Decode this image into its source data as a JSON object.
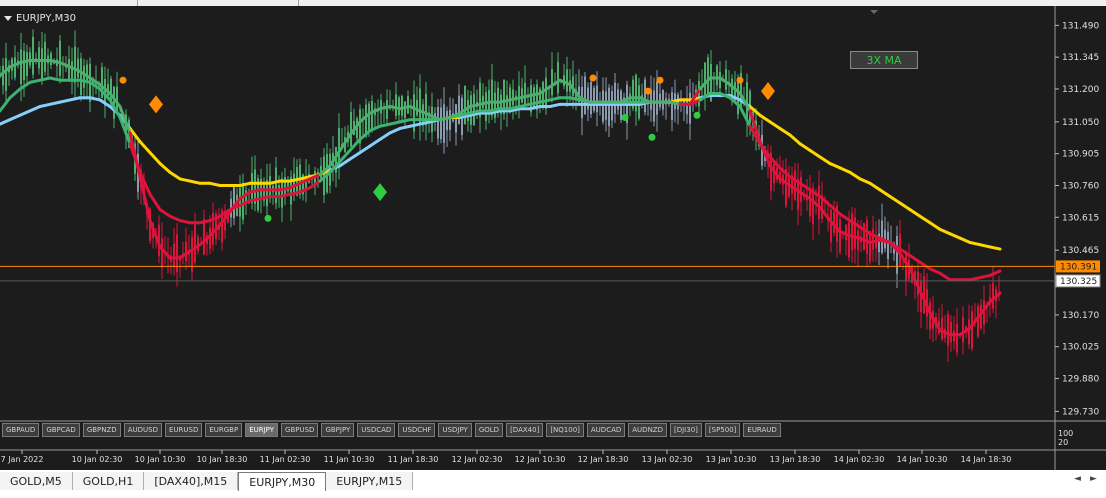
{
  "window": {
    "symbol_timeframe": "EURJPY,M30",
    "indicator_button": "3X MA"
  },
  "symbol_buttons": [
    {
      "label": "GBPAUD",
      "active": false
    },
    {
      "label": "GBPCAD",
      "active": false
    },
    {
      "label": "GBPNZD",
      "active": false
    },
    {
      "label": "AUDUSD",
      "active": false
    },
    {
      "label": "EURUSD",
      "active": false
    },
    {
      "label": "EURGBP",
      "active": false
    },
    {
      "label": "EURJPY",
      "active": true
    },
    {
      "label": "GBPUSD",
      "active": false
    },
    {
      "label": "GBPJPY",
      "active": false
    },
    {
      "label": "USDCAD",
      "active": false
    },
    {
      "label": "USDCHF",
      "active": false
    },
    {
      "label": "USDJPY",
      "active": false
    },
    {
      "label": "GOLD",
      "active": false
    },
    {
      "label": "[DAX40]",
      "active": false
    },
    {
      "label": "[NQ100]",
      "active": false
    },
    {
      "label": "AUDCAD",
      "active": false
    },
    {
      "label": "AUDNZD",
      "active": false
    },
    {
      "label": "[DJI30]",
      "active": false
    },
    {
      "label": "[SP500]",
      "active": false
    },
    {
      "label": "EURAUD",
      "active": false
    }
  ],
  "tabs": [
    {
      "label": "GOLD,M5",
      "active": false
    },
    {
      "label": "GOLD,H1",
      "active": false
    },
    {
      "label": "[DAX40],M15",
      "active": false
    },
    {
      "label": "EURJPY,M30",
      "active": true
    },
    {
      "label": "EURJPY,M15",
      "active": false
    }
  ],
  "chart_data": {
    "type": "line",
    "title": "EURJPY,M30",
    "ylim": [
      129.7,
      131.56
    ],
    "y_ticks": [
      131.49,
      131.345,
      131.2,
      131.05,
      130.905,
      130.76,
      130.615,
      130.465,
      130.32,
      130.17,
      130.025,
      129.88,
      129.73
    ],
    "x_tick_labels": [
      "7 Jan 2022",
      "10 Jan 02:30",
      "10 Jan 10:30",
      "10 Jan 18:30",
      "11 Jan 02:30",
      "11 Jan 10:30",
      "11 Jan 18:30",
      "12 Jan 02:30",
      "12 Jan 10:30",
      "12 Jan 18:30",
      "13 Jan 02:30",
      "13 Jan 10:30",
      "13 Jan 18:30",
      "14 Jan 02:30",
      "14 Jan 10:30",
      "14 Jan 18:30"
    ],
    "x": [
      0,
      10,
      20,
      30,
      40,
      50,
      60,
      70,
      80,
      90,
      100,
      110,
      120,
      130,
      140,
      150,
      160,
      170,
      180,
      190,
      200,
      210,
      220,
      230,
      240,
      250,
      260,
      270,
      280,
      290,
      300,
      310,
      320,
      330,
      340,
      350,
      360,
      370,
      380,
      390,
      400,
      410,
      420,
      430,
      440,
      450,
      460,
      470,
      480,
      490,
      500,
      510,
      520,
      530,
      540,
      550,
      560,
      570,
      580,
      590,
      600,
      610,
      620,
      630,
      640,
      650,
      660,
      670,
      680,
      690,
      700,
      710,
      720,
      730,
      740,
      750,
      760,
      770,
      780,
      790,
      800,
      810,
      820,
      830,
      840,
      850,
      860,
      870,
      880,
      890,
      900,
      910,
      920,
      930,
      940,
      950,
      960,
      970,
      980,
      990,
      1000
    ],
    "series": [
      {
        "name": "fast",
        "color_up": "#4caf6e",
        "color_down": "#dc143c",
        "values": [
          131.26,
          131.3,
          131.32,
          131.33,
          131.33,
          131.33,
          131.32,
          131.3,
          131.28,
          131.25,
          131.22,
          131.18,
          131.12,
          131.0,
          130.8,
          130.6,
          130.48,
          130.43,
          130.43,
          130.46,
          130.49,
          130.53,
          130.58,
          130.64,
          130.7,
          130.73,
          130.74,
          130.74,
          130.74,
          130.75,
          130.77,
          130.79,
          130.81,
          130.85,
          130.92,
          130.99,
          131.05,
          131.09,
          131.11,
          131.12,
          131.11,
          131.12,
          131.1,
          131.08,
          131.06,
          131.07,
          131.09,
          131.12,
          131.13,
          131.14,
          131.14,
          131.15,
          131.16,
          131.17,
          131.18,
          131.21,
          131.24,
          131.22,
          131.16,
          131.14,
          131.14,
          131.14,
          131.14,
          131.16,
          131.16,
          131.14,
          131.14,
          131.14,
          131.13,
          131.13,
          131.2,
          131.25,
          131.25,
          131.22,
          131.18,
          131.1,
          130.96,
          130.85,
          130.79,
          130.76,
          130.73,
          130.7,
          130.66,
          130.6,
          130.55,
          130.53,
          130.52,
          130.5,
          130.51,
          130.5,
          130.45,
          130.38,
          130.28,
          130.18,
          130.1,
          130.08,
          130.08,
          130.11,
          130.17,
          130.23,
          130.27
        ]
      },
      {
        "name": "mid",
        "color_up": "#3cb371",
        "color_down": "#dc143c",
        "values": [
          131.1,
          131.16,
          131.2,
          131.23,
          131.24,
          131.25,
          131.24,
          131.24,
          131.24,
          131.23,
          131.2,
          131.15,
          131.07,
          130.95,
          130.82,
          130.72,
          130.65,
          130.62,
          130.6,
          130.59,
          130.59,
          130.6,
          130.62,
          130.65,
          130.67,
          130.69,
          130.7,
          130.71,
          130.71,
          130.72,
          130.73,
          130.75,
          130.78,
          130.82,
          130.87,
          130.92,
          130.97,
          131.01,
          131.03,
          131.04,
          131.05,
          131.06,
          131.06,
          131.06,
          131.06,
          131.07,
          131.08,
          131.09,
          131.1,
          131.1,
          131.11,
          131.11,
          131.12,
          131.13,
          131.14,
          131.15,
          131.16,
          131.16,
          131.15,
          131.14,
          131.14,
          131.14,
          131.14,
          131.14,
          131.14,
          131.14,
          131.14,
          131.14,
          131.13,
          131.13,
          131.15,
          131.18,
          131.18,
          131.16,
          131.12,
          131.03,
          130.95,
          130.89,
          130.84,
          130.8,
          130.77,
          130.74,
          130.71,
          130.67,
          130.63,
          130.6,
          130.57,
          130.54,
          130.52,
          130.5,
          130.47,
          130.44,
          130.41,
          130.38,
          130.36,
          130.33,
          130.33,
          130.33,
          130.34,
          130.35,
          130.37
        ]
      },
      {
        "name": "slow",
        "color_up": "#87cefa",
        "color_down": "#ffd700",
        "values": [
          131.04,
          131.06,
          131.08,
          131.1,
          131.12,
          131.13,
          131.14,
          131.15,
          131.16,
          131.16,
          131.15,
          131.12,
          131.08,
          131.02,
          130.96,
          130.91,
          130.86,
          130.82,
          130.79,
          130.78,
          130.77,
          130.77,
          130.76,
          130.76,
          130.76,
          130.77,
          130.77,
          130.77,
          130.78,
          130.78,
          130.79,
          130.8,
          130.81,
          130.83,
          130.85,
          130.88,
          130.91,
          130.94,
          130.97,
          131.0,
          131.02,
          131.03,
          131.04,
          131.05,
          131.06,
          131.07,
          131.07,
          131.08,
          131.09,
          131.09,
          131.1,
          131.1,
          131.11,
          131.11,
          131.12,
          131.12,
          131.13,
          131.13,
          131.13,
          131.13,
          131.13,
          131.13,
          131.13,
          131.13,
          131.13,
          131.14,
          131.14,
          131.14,
          131.15,
          131.15,
          131.16,
          131.17,
          131.17,
          131.17,
          131.15,
          131.12,
          131.08,
          131.05,
          131.02,
          130.99,
          130.95,
          130.92,
          130.89,
          130.86,
          130.84,
          130.82,
          130.79,
          130.77,
          130.74,
          130.71,
          130.68,
          130.65,
          130.62,
          130.59,
          130.56,
          130.54,
          130.52,
          130.5,
          130.49,
          130.48,
          130.47
        ]
      }
    ],
    "grid": false,
    "current_price": {
      "label": "130.391",
      "value": 130.391,
      "color": "#ff8c00"
    },
    "bid_price": {
      "label": "130.325",
      "value": 130.325
    },
    "indicator_scale": [
      "100",
      "20"
    ],
    "colors": {
      "background": "#1c1c1c",
      "bull": "#4caf6e",
      "bear": "#dc143c",
      "neutral": "#8a9bb0",
      "slow_up": "#87cefa",
      "slow_down": "#ffd700",
      "marker_orange": "#ff8c00",
      "marker_green": "#2ecc40"
    }
  }
}
